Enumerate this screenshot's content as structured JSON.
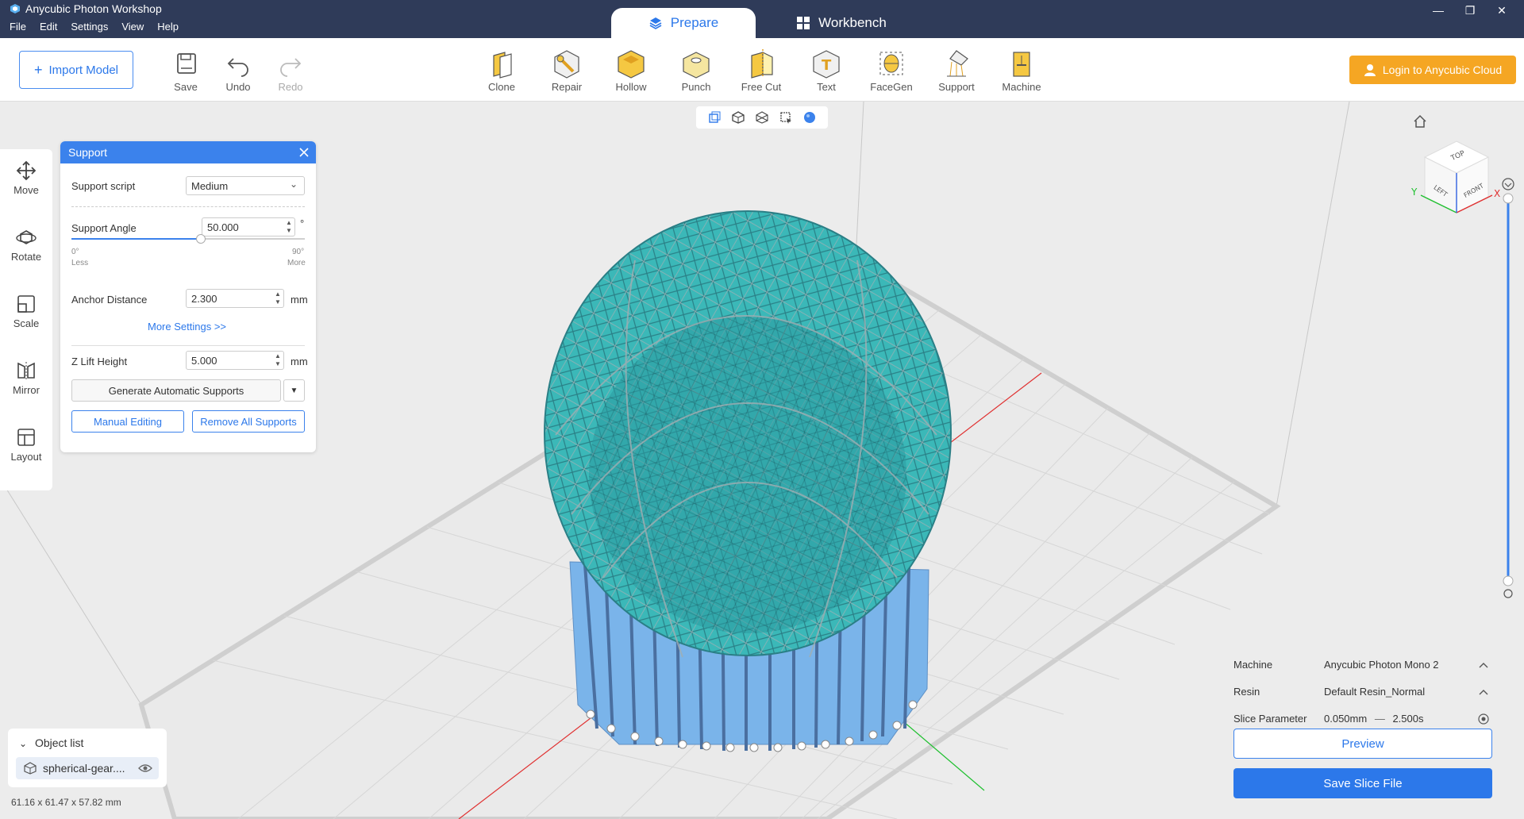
{
  "app": {
    "title": "Anycubic Photon Workshop",
    "menu": [
      "File",
      "Edit",
      "Settings",
      "View",
      "Help"
    ],
    "tabs": [
      {
        "label": "Prepare",
        "active": true
      },
      {
        "label": "Workbench",
        "active": false
      }
    ]
  },
  "toolbar": {
    "import_label": "Import Model",
    "save_label": "Save",
    "undo_label": "Undo",
    "redo_label": "Redo",
    "tools": [
      "Clone",
      "Repair",
      "Hollow",
      "Punch",
      "Free Cut",
      "Text",
      "FaceGen",
      "Support",
      "Machine"
    ],
    "login_label": "Login to Anycubic Cloud"
  },
  "left_tools": [
    "Move",
    "Rotate",
    "Scale",
    "Mirror",
    "Layout"
  ],
  "support_panel": {
    "title": "Support",
    "script_label": "Support script",
    "script_value": "Medium",
    "angle_label": "Support Angle",
    "angle_value": "50.000",
    "angle_unit": "°",
    "angle_fraction": 0.5556,
    "min_label": "0°",
    "max_label": "90°",
    "less_label": "Less",
    "more_label": "More",
    "anchor_label": "Anchor Distance",
    "anchor_value": "2.300",
    "anchor_unit": "mm",
    "more_settings": "More Settings >>",
    "zlift_label": "Z Lift Height",
    "zlift_value": "5.000",
    "zlift_unit": "mm",
    "generate_label": "Generate Automatic Supports",
    "manual_label": "Manual Editing",
    "remove_label": "Remove All Supports"
  },
  "object_list": {
    "title": "Object list",
    "items": [
      {
        "name": "spherical-gear...."
      }
    ],
    "dimensions": "61.16 x 61.47 x 57.82 mm"
  },
  "nav_cube": {
    "top": "TOP",
    "left": "LEFT",
    "front": "FRONT",
    "axis_x": "X",
    "axis_y": "Y"
  },
  "slice": {
    "machine_label": "Machine",
    "machine_value": "Anycubic Photon Mono 2",
    "resin_label": "Resin",
    "resin_value": "Default Resin_Normal",
    "param_label": "Slice Parameter",
    "param_layer": "0.050mm",
    "param_sep": "—",
    "param_exposure": "2.500s",
    "preview_label": "Preview",
    "save_label": "Save Slice File"
  },
  "colors": {
    "accent": "#2c78ea",
    "titlebar": "#2f3b59",
    "login": "#f5a623",
    "model": "#3bb8b8",
    "supports": "#6a9fd8"
  }
}
